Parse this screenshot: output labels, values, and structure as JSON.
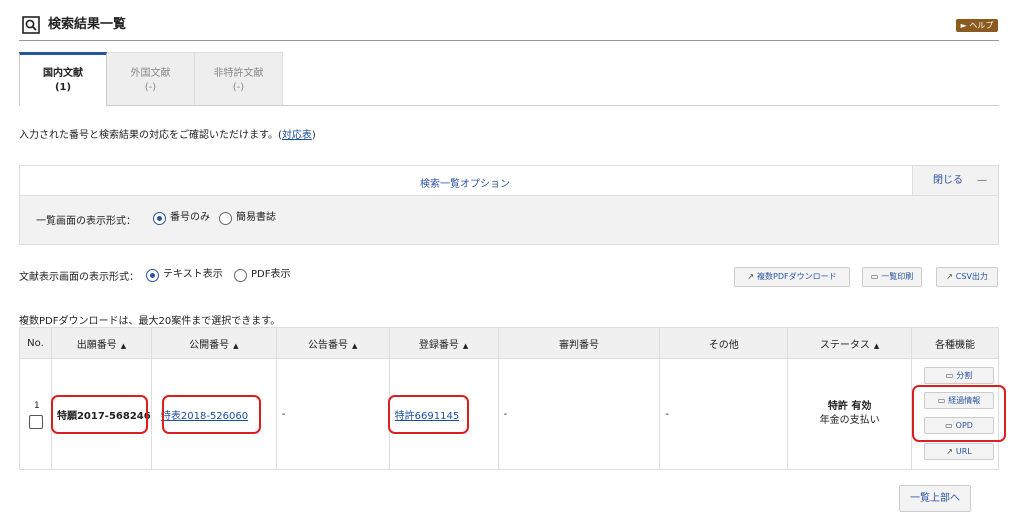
{
  "header": {
    "title": "検索結果一覧",
    "help_label": "► ヘルプ"
  },
  "tabs": [
    {
      "label": "国内文献",
      "count": "(1)",
      "active": true
    },
    {
      "label": "外国文献",
      "count": "(-)",
      "active": false
    },
    {
      "label": "非特許文献",
      "count": "(-)",
      "active": false
    }
  ],
  "notice": {
    "text_before": "入力された番号と検索結果の対応をご確認いただけます。(",
    "link": "対応表",
    "text_after": ")"
  },
  "options": {
    "title": "検索一覧オプション",
    "close_label": "閉じる",
    "close_symbol": "—",
    "list_format_label": "一覧画面の表示形式：",
    "list_format_options": [
      "番号のみ",
      "簡易書誌"
    ],
    "list_format_selected": "番号のみ"
  },
  "doc_display": {
    "label": "文献表示画面の表示形式：",
    "options": [
      "テキスト表示",
      "PDF表示"
    ],
    "selected": "テキスト表示"
  },
  "toolbar": {
    "multi_pdf_label": "複数PDFダウンロード",
    "print_label": "一覧印刷",
    "csv_label": "CSV出力"
  },
  "limit_note": "複数PDFダウンロードは、最大20案件まで選択できます。",
  "table": {
    "columns": [
      {
        "label": "No.",
        "sortable": false
      },
      {
        "label": "出願番号",
        "sortable": true
      },
      {
        "label": "公開番号",
        "sortable": true
      },
      {
        "label": "公告番号",
        "sortable": true
      },
      {
        "label": "登録番号",
        "sortable": true
      },
      {
        "label": "審判番号",
        "sortable": false
      },
      {
        "label": "その他",
        "sortable": false
      },
      {
        "label": "ステータス",
        "sortable": true
      },
      {
        "label": "各種機能",
        "sortable": false
      }
    ],
    "sort_indicator": "▲",
    "rows": [
      {
        "no": "1",
        "application_number": "特願2017-568246",
        "publication_number": "特表2018-526060",
        "announcement_number": "-",
        "registration_number": "特許6691145",
        "trial_number": "-",
        "other": "-",
        "status_main": "特許 有効",
        "status_sub": "年金の支払い",
        "functions": [
          "分割",
          "経過情報",
          "OPD",
          "URL"
        ]
      }
    ]
  },
  "back_to_top_label": "一覧上部へ",
  "colors": {
    "accent_blue": "#2a54a0",
    "help_brown": "#8b5a1e",
    "highlight_red": "#d91f1f"
  }
}
